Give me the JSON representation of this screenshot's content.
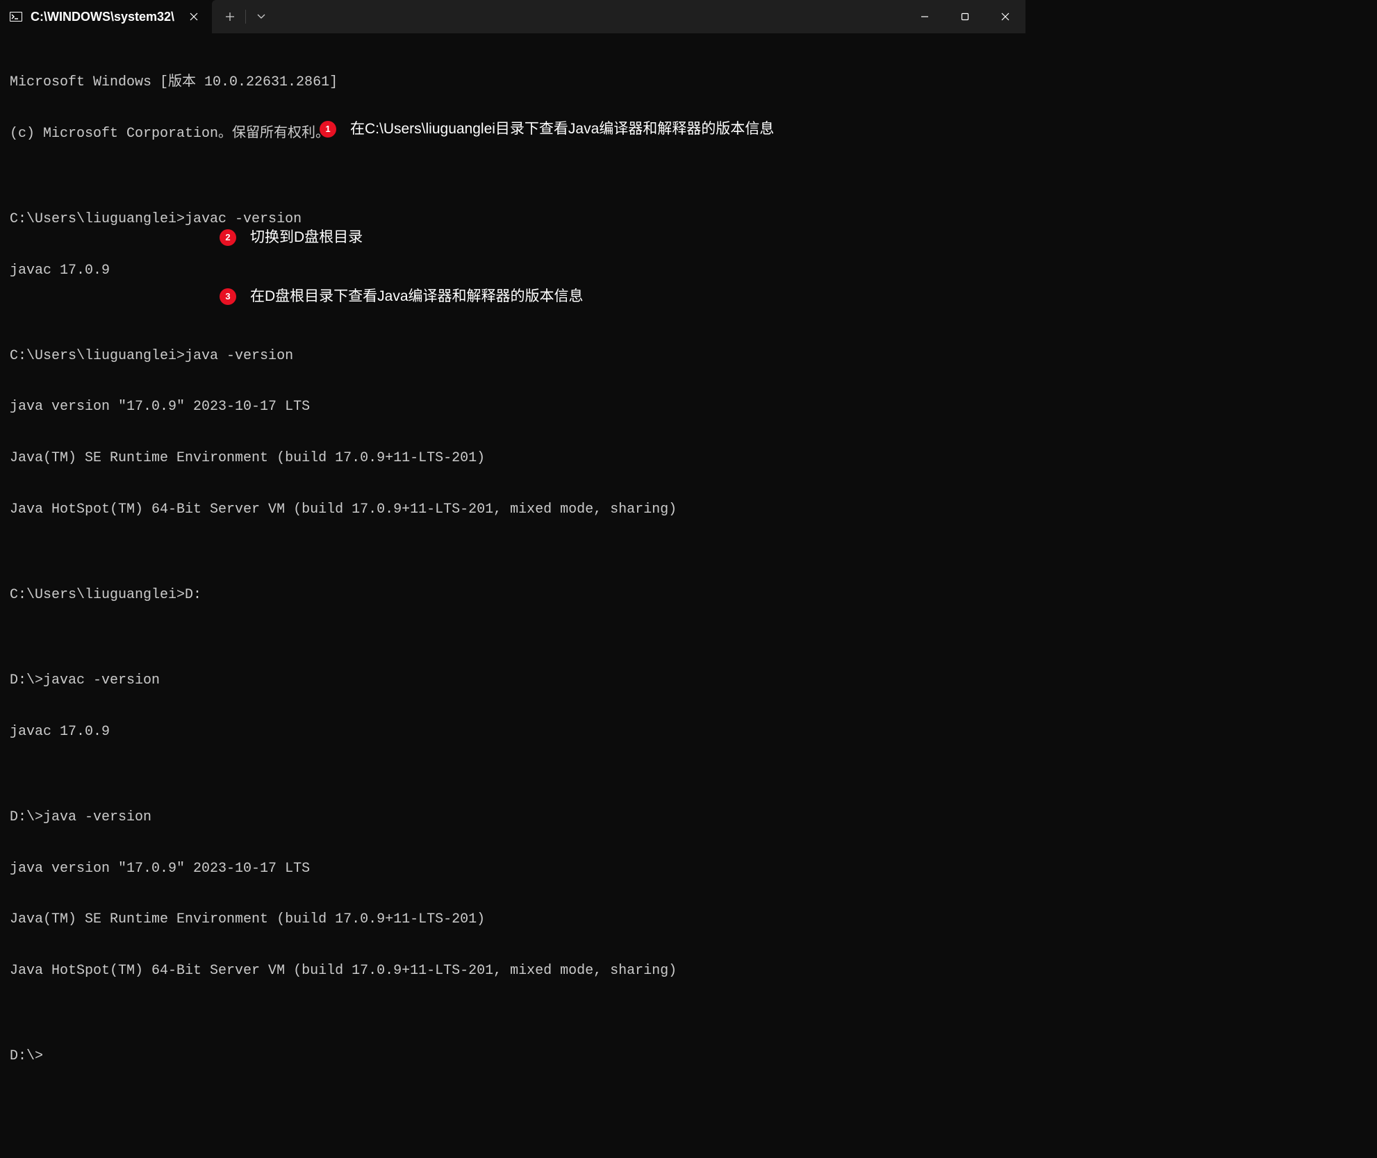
{
  "titlebar": {
    "tab_title": "C:\\WINDOWS\\system32\\"
  },
  "terminal": {
    "lines": [
      "Microsoft Windows [版本 10.0.22631.2861]",
      "(c) Microsoft Corporation。保留所有权利。",
      "",
      "C:\\Users\\liuguanglei>javac -version",
      "javac 17.0.9",
      "",
      "C:\\Users\\liuguanglei>java -version",
      "java version \"17.0.9\" 2023-10-17 LTS",
      "Java(TM) SE Runtime Environment (build 17.0.9+11-LTS-201)",
      "Java HotSpot(TM) 64-Bit Server VM (build 17.0.9+11-LTS-201, mixed mode, sharing)",
      "",
      "C:\\Users\\liuguanglei>D:",
      "",
      "D:\\>javac -version",
      "javac 17.0.9",
      "",
      "D:\\>java -version",
      "java version \"17.0.9\" 2023-10-17 LTS",
      "Java(TM) SE Runtime Environment (build 17.0.9+11-LTS-201)",
      "Java HotSpot(TM) 64-Bit Server VM (build 17.0.9+11-LTS-201, mixed mode, sharing)",
      "",
      "D:\\>"
    ]
  },
  "annotations": {
    "a1": {
      "num": "1",
      "text": "在C:\\Users\\liuguanglei目录下查看Java编译器和解释器的版本信息"
    },
    "a2": {
      "num": "2",
      "text": "切换到D盘根目录"
    },
    "a3": {
      "num": "3",
      "text": "在D盘根目录下查看Java编译器和解释器的版本信息"
    }
  }
}
